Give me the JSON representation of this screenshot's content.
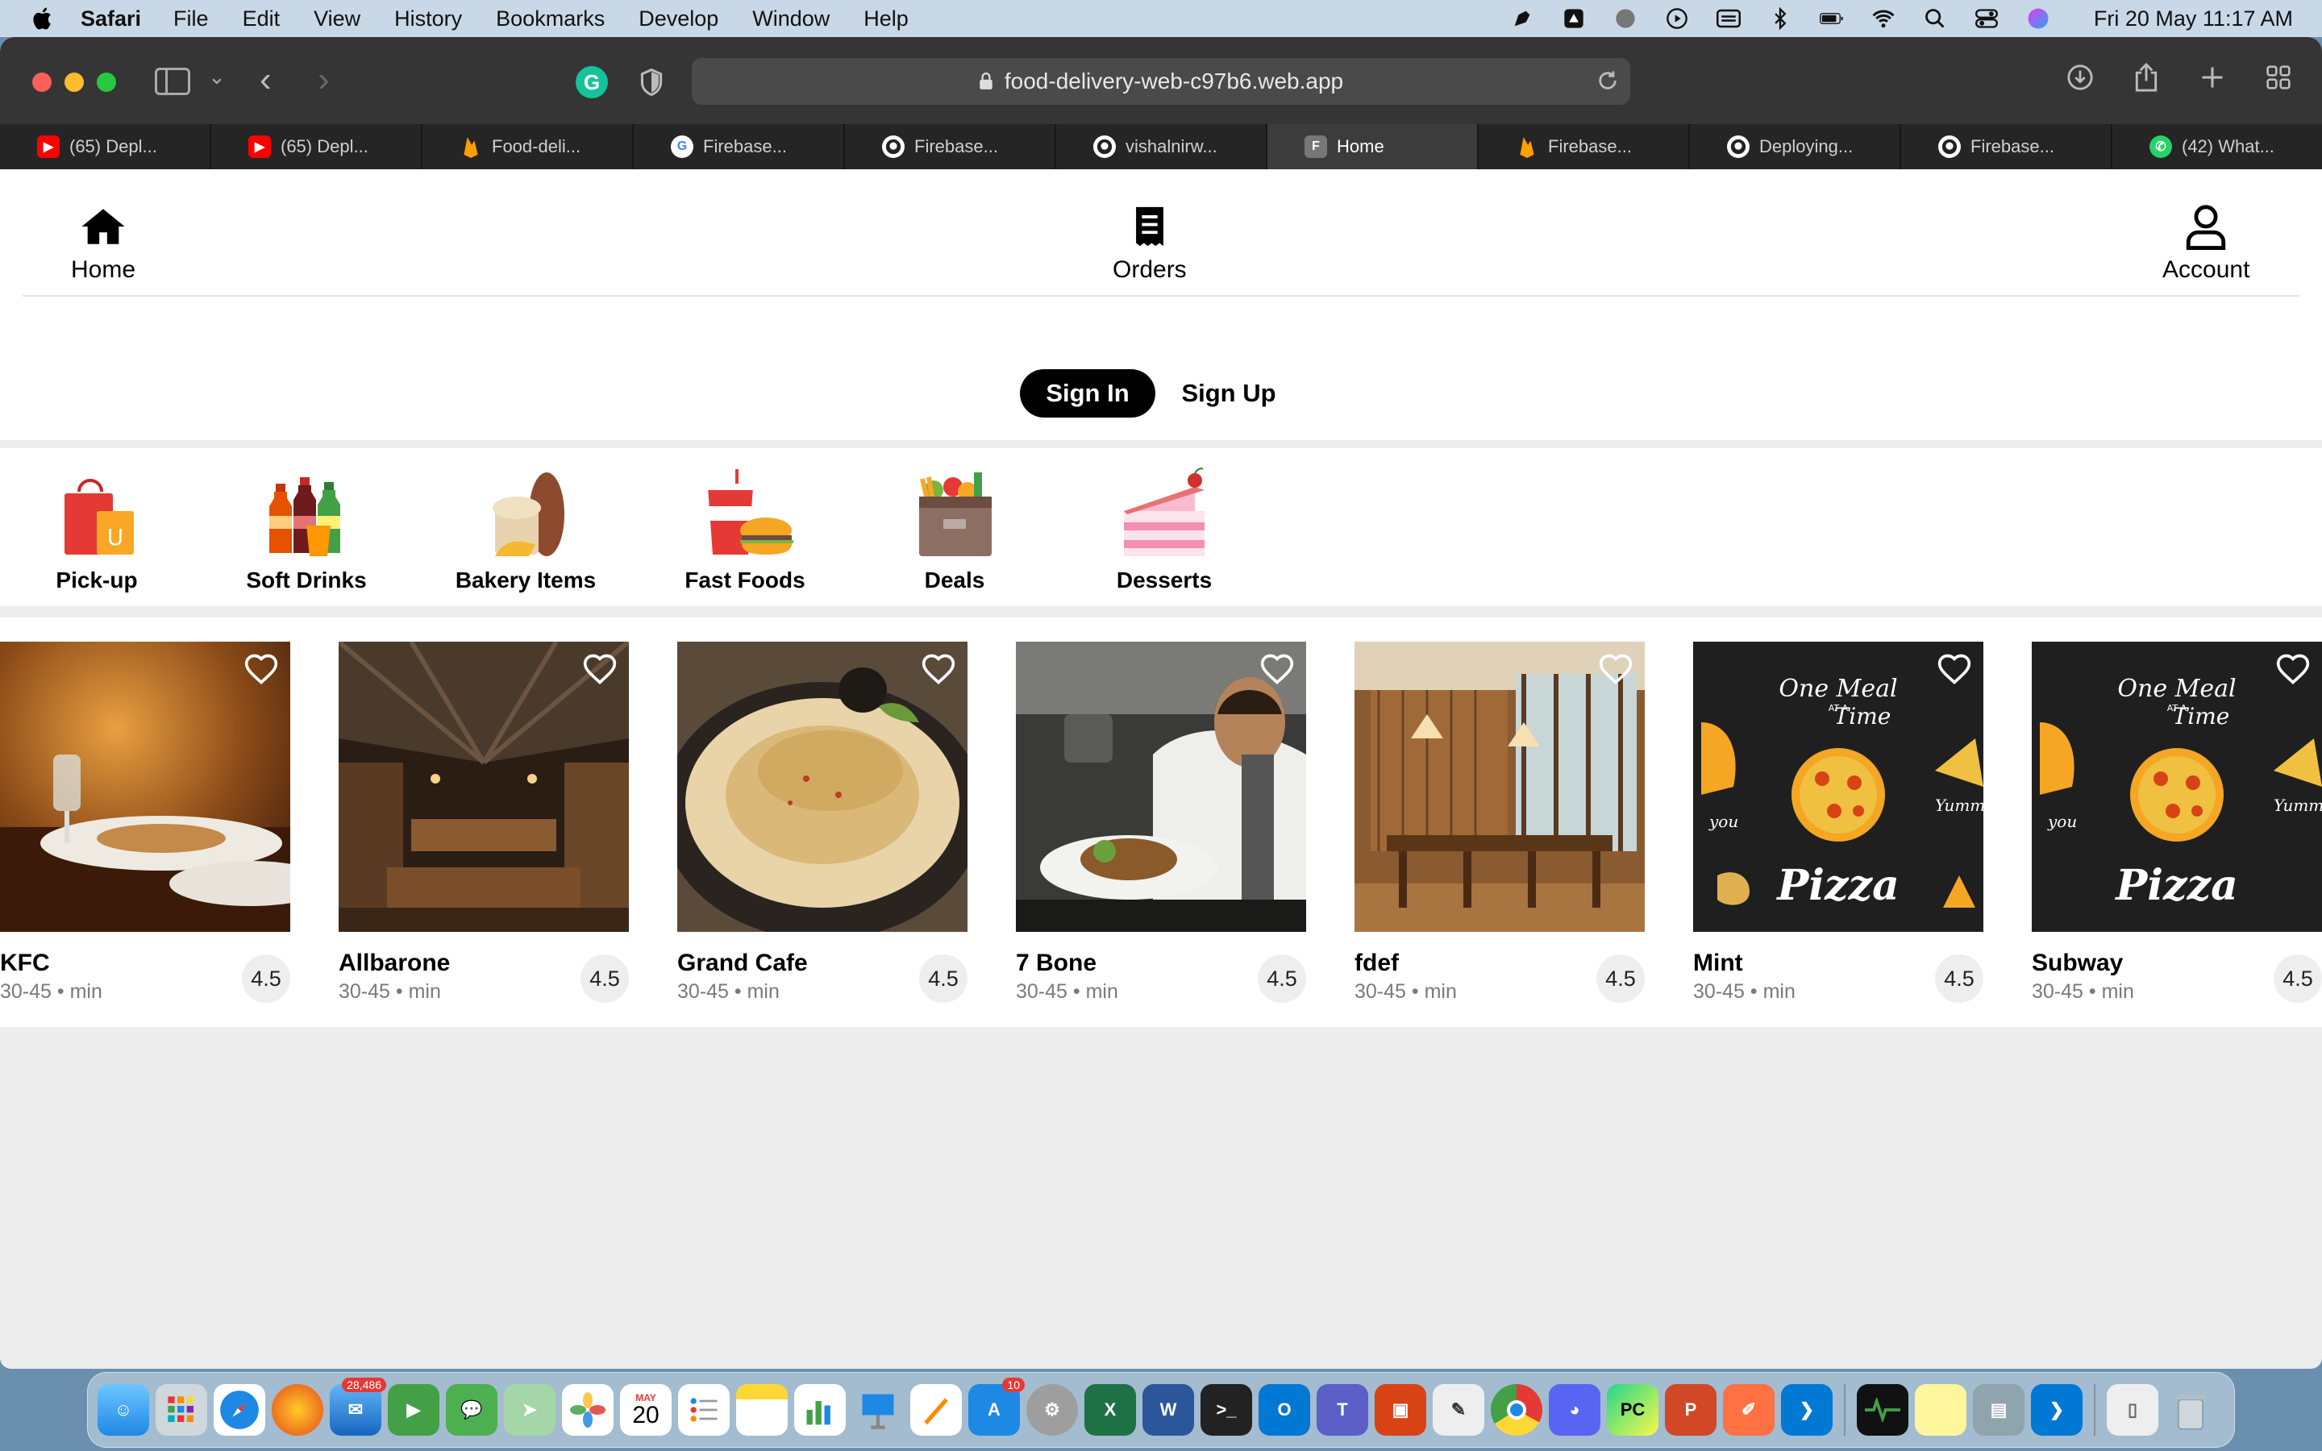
{
  "menubar": {
    "app_name": "Safari",
    "menus": [
      "File",
      "Edit",
      "View",
      "History",
      "Bookmarks",
      "Develop",
      "Window",
      "Help"
    ],
    "clock": "Fri 20 May  11:17 AM",
    "status_icons": [
      "pen-icon",
      "drive-icon",
      "globe-icon",
      "play-icon",
      "keyboard-icon",
      "bluetooth-icon",
      "battery-icon",
      "wifi-icon",
      "search-icon",
      "control-center-icon",
      "siri-icon"
    ]
  },
  "browser": {
    "url": "food-delivery-web-c97b6.web.app",
    "tabs": [
      {
        "label": "(65) Depl...",
        "icon": "youtube-icon",
        "color": "#ff0000",
        "active": false
      },
      {
        "label": "(65) Depl...",
        "icon": "youtube-icon",
        "color": "#ff0000",
        "active": false
      },
      {
        "label": "Food-deli...",
        "icon": "firebase-icon",
        "color": "#ffa000",
        "active": false
      },
      {
        "label": "Firebase...",
        "icon": "google-icon",
        "color": "#ffffff",
        "active": false
      },
      {
        "label": "Firebase...",
        "icon": "github-icon",
        "color": "#ffffff",
        "active": false
      },
      {
        "label": "vishalnirw...",
        "icon": "github-icon",
        "color": "#ffffff",
        "active": false
      },
      {
        "label": "Home",
        "icon": "f-letter-icon",
        "color": "#777777",
        "active": true
      },
      {
        "label": "Firebase...",
        "icon": "firebase-icon",
        "color": "#ffa000",
        "active": false
      },
      {
        "label": "Deploying...",
        "icon": "github-icon",
        "color": "#ffffff",
        "active": false
      },
      {
        "label": "Firebase...",
        "icon": "github-icon",
        "color": "#ffffff",
        "active": false
      },
      {
        "label": "(42) What...",
        "icon": "whatsapp-icon",
        "color": "#25d366",
        "active": false
      }
    ]
  },
  "nav": {
    "home": "Home",
    "orders": "Orders",
    "account": "Account"
  },
  "auth": {
    "sign_in": "Sign In",
    "sign_up": "Sign Up"
  },
  "categories": [
    {
      "label": "Pick-up",
      "icon": "shopping-bag-icon"
    },
    {
      "label": "Soft Drinks",
      "icon": "soda-bottles-icon"
    },
    {
      "label": "Bakery Items",
      "icon": "bread-icon"
    },
    {
      "label": "Fast Foods",
      "icon": "burger-fries-icon"
    },
    {
      "label": "Deals",
      "icon": "grocery-box-icon"
    },
    {
      "label": "Desserts",
      "icon": "cake-icon"
    }
  ],
  "restaurants": [
    {
      "name": "KFC",
      "meta": "30-45 • min",
      "rating": "4.5",
      "photo": "dining-table-photo"
    },
    {
      "name": "Allbarone",
      "meta": "30-45 • min",
      "rating": "4.5",
      "photo": "restaurant-interior-photo"
    },
    {
      "name": "Grand Cafe",
      "meta": "30-45 • min",
      "rating": "4.5",
      "photo": "hummus-plate-photo"
    },
    {
      "name": "7 Bone",
      "meta": "30-45 • min",
      "rating": "4.5",
      "photo": "chef-plating-photo"
    },
    {
      "name": "fdef",
      "meta": "30-45 • min",
      "rating": "4.5",
      "photo": "dining-room-photo"
    },
    {
      "name": "Mint",
      "meta": "30-45 • min",
      "rating": "4.5",
      "photo": "pizza-chalkboard-photo",
      "poster": {
        "line1": "One Meal",
        "small": "AT A",
        "line2": "Time",
        "main": "Pizza",
        "side1": "Yummy",
        "side2": "you"
      }
    },
    {
      "name": "Subway",
      "meta": "30-45 • min",
      "rating": "4.5",
      "photo": "pizza-chalkboard-photo",
      "poster": {
        "line1": "One Meal",
        "small": "AT A",
        "line2": "Time",
        "main": "Pizza",
        "side1": "Yummy",
        "side2": "you"
      }
    }
  ],
  "dock": {
    "badges": {
      "mail": "28,486",
      "calendar_month": "MAY",
      "calendar_day": "20",
      "appstore": "10"
    },
    "apps": [
      "finder-icon",
      "launchpad-icon",
      "safari-icon",
      "firefox-icon",
      "mail-icon",
      "facetime-icon",
      "messages-icon",
      "maps-icon",
      "photos-icon",
      "calendar-icon",
      "reminders-icon",
      "notes-icon",
      "numbers-icon",
      "keynote-icon",
      "pages-icon",
      "appstore-icon",
      "settings-icon",
      "excel-icon",
      "word-icon",
      "terminal-icon",
      "outlook-icon",
      "teams-icon",
      "remote-desktop-icon",
      "textedit-icon",
      "chrome-icon",
      "discord-icon",
      "pycharm-icon",
      "powerpoint-icon",
      "pen-app-icon",
      "vscode-icon",
      "activity-monitor-icon",
      "stickies-icon",
      "preview-icon",
      "vscode-icon",
      "archive-icon",
      "trash-icon"
    ]
  },
  "colors": {
    "accent_black": "#000000",
    "toolbar": "#353535",
    "menubar": "#c9d8e6"
  }
}
